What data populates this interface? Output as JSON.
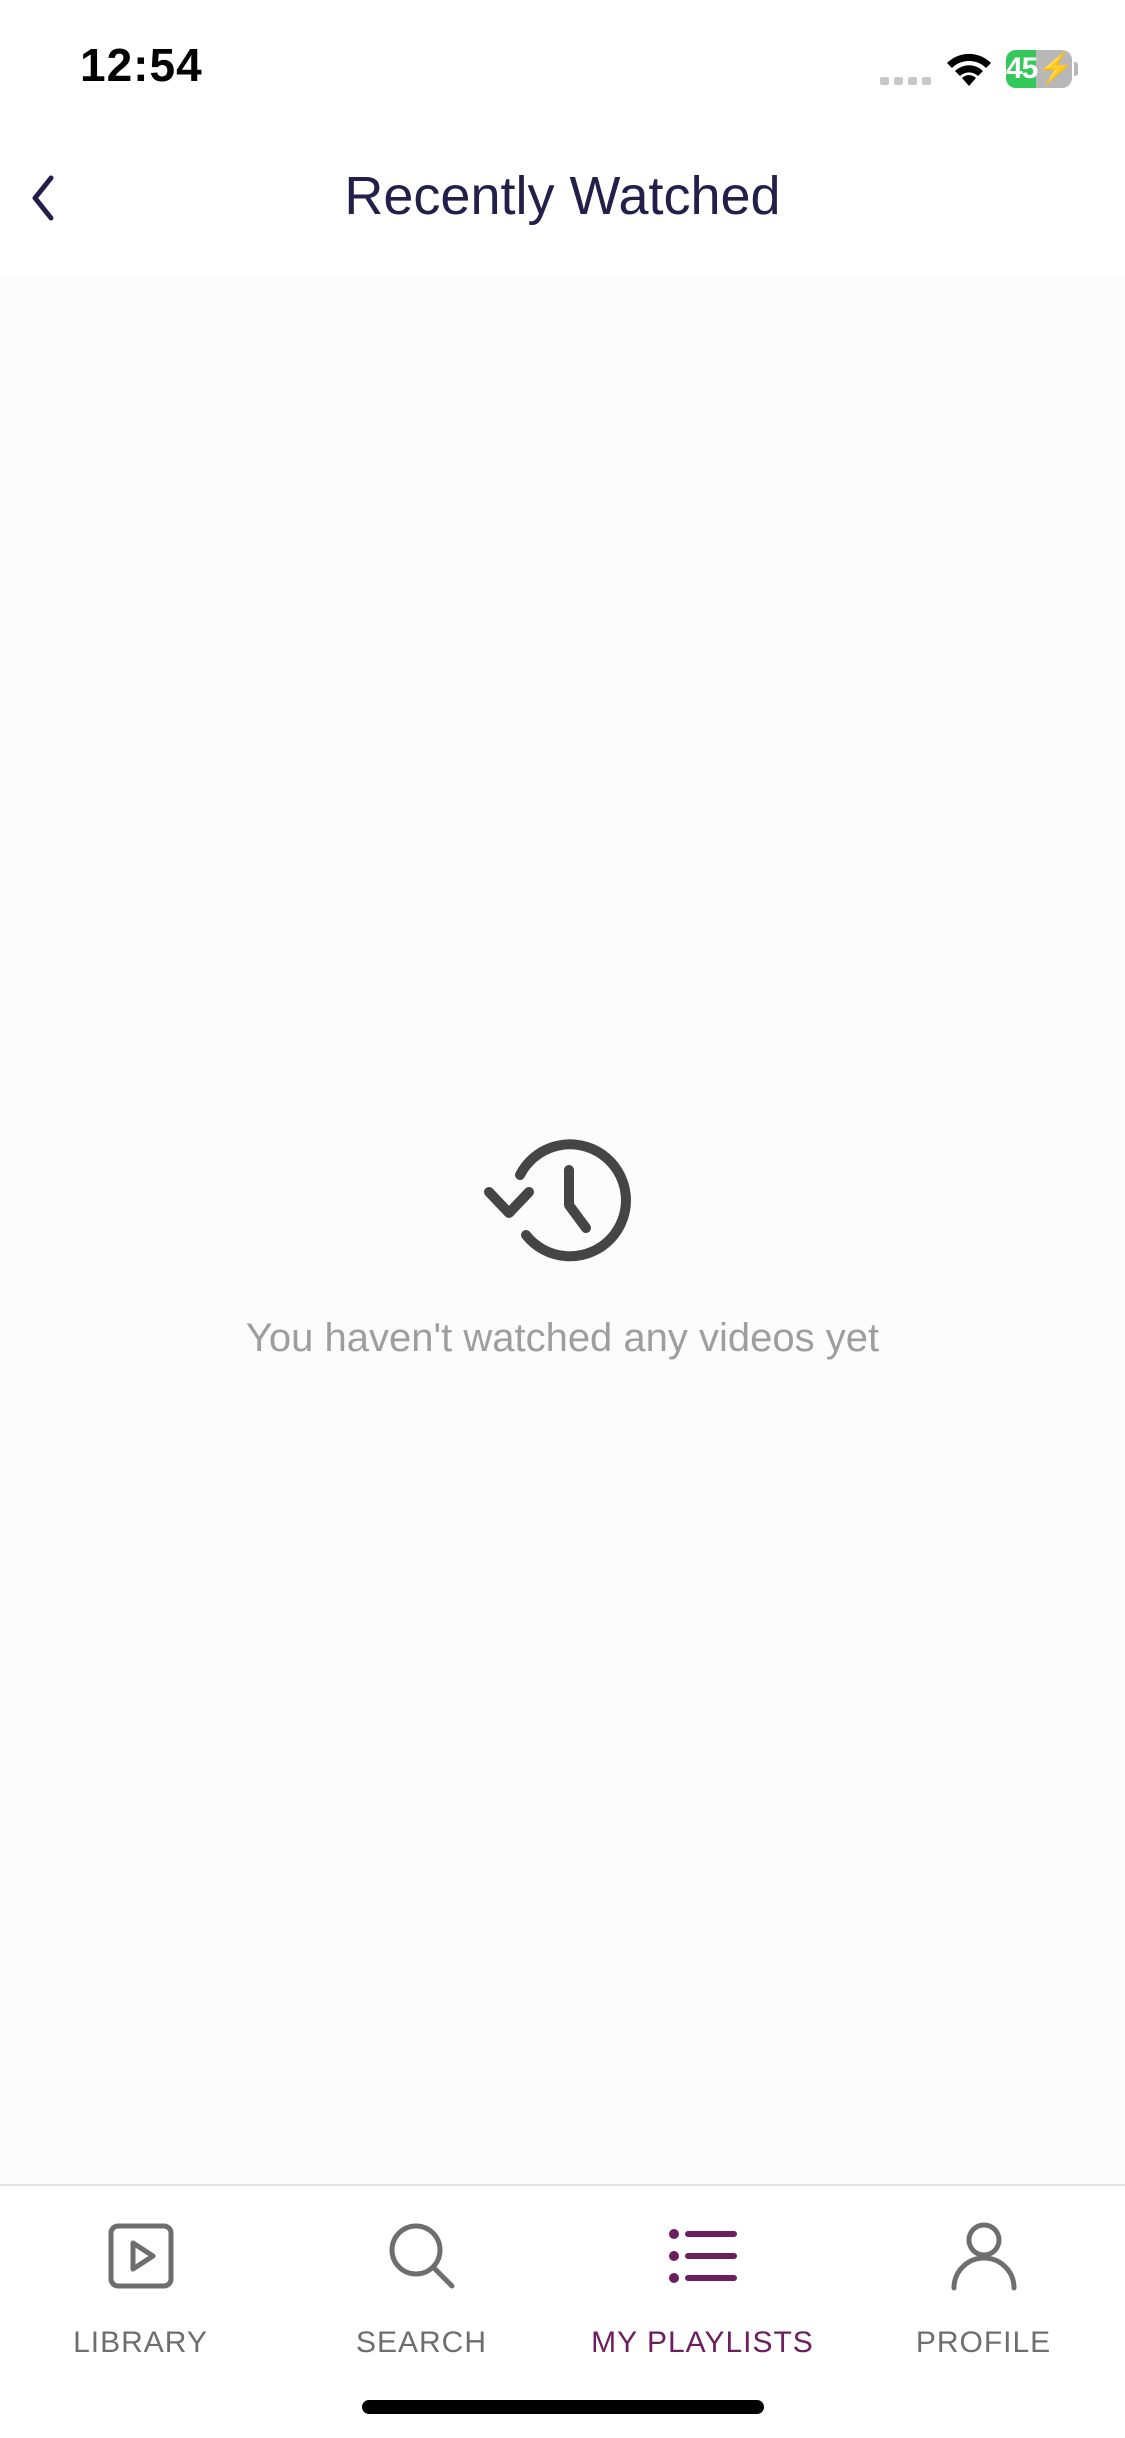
{
  "status_bar": {
    "time": "12:54",
    "battery_level": "45",
    "battery_fraction": 0.45,
    "icons": [
      "signal-icon",
      "wifi-icon",
      "battery-charging-icon"
    ]
  },
  "header": {
    "title": "Recently Watched",
    "back_icon": "chevron-left-icon",
    "title_color": "#221f4a"
  },
  "empty_state": {
    "icon": "history-icon",
    "message": "You haven't watched any videos yet"
  },
  "tab_bar": {
    "active_color": "#6b1f5e",
    "inactive_color": "#6e6e6e",
    "tabs": [
      {
        "label": "LIBRARY",
        "icon": "play-square-icon",
        "active": false
      },
      {
        "label": "SEARCH",
        "icon": "search-icon",
        "active": false
      },
      {
        "label": "MY PLAYLISTS",
        "icon": "list-icon",
        "active": true
      },
      {
        "label": "PROFILE",
        "icon": "person-icon",
        "active": false
      }
    ]
  }
}
